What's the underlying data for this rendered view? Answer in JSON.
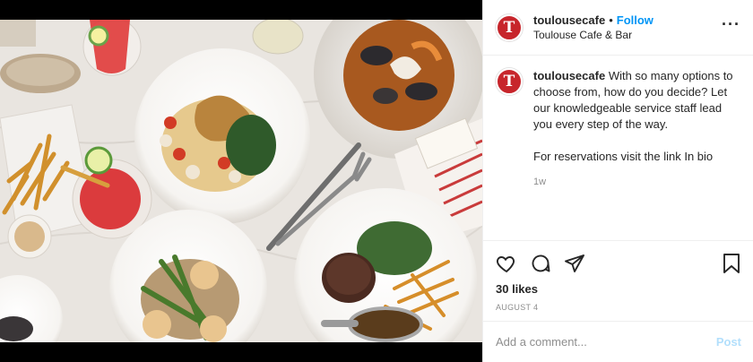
{
  "header": {
    "avatar_letter": "T",
    "username": "toulousecafe",
    "separator": "•",
    "follow_label": "Follow",
    "location": "Toulouse Cafe & Bar",
    "more_label": "···"
  },
  "caption": {
    "username": "toulousecafe",
    "text": "With so many options to choose from, how do you decide? Let our knowledgeable service staff lead you every step of the way.",
    "reservation": "For reservations visit the link In bio",
    "age": "1w"
  },
  "actions": {
    "likes": "30 likes",
    "date": "AUGUST 4"
  },
  "comment": {
    "placeholder": "Add a comment...",
    "post_label": "Post"
  },
  "colors": {
    "brand_red": "#c7252b",
    "follow_blue": "#0095f6",
    "post_disabled": "#b2dffc"
  },
  "icons": [
    "heart-icon",
    "comment-icon",
    "share-icon",
    "bookmark-icon",
    "more-icon"
  ]
}
